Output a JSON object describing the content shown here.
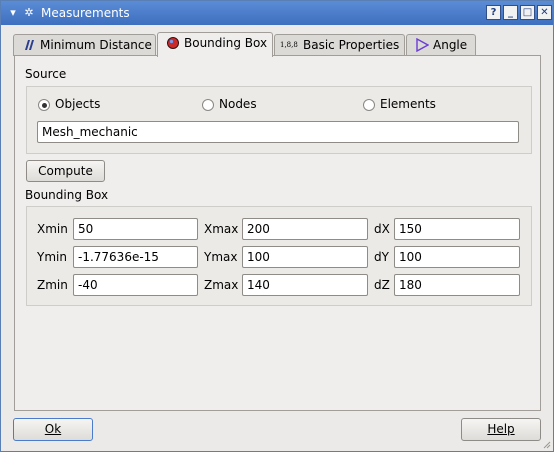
{
  "window": {
    "title": "Measurements",
    "controls": [
      "?",
      "_",
      "□",
      "✕"
    ]
  },
  "tabs": [
    {
      "label": "Minimum Distance",
      "icon": "minimum-distance-icon",
      "active": false
    },
    {
      "label": "Bounding Box",
      "icon": "bounding-box-icon",
      "active": true
    },
    {
      "label": "Basic Properties",
      "icon": "basic-properties-icon",
      "icon_text": "1,8,8",
      "active": false
    },
    {
      "label": "Angle",
      "icon": "angle-icon",
      "active": false
    }
  ],
  "source": {
    "label": "Source",
    "options": [
      {
        "label": "Objects",
        "selected": true
      },
      {
        "label": "Nodes",
        "selected": false
      },
      {
        "label": "Elements",
        "selected": false
      }
    ],
    "object_name": "Mesh_mechanic"
  },
  "compute_label": "Compute",
  "bbox": {
    "label": "Bounding Box",
    "rows": [
      {
        "min_label": "Xmin",
        "min": "50",
        "max_label": "Xmax",
        "max": "200",
        "d_label": "dX",
        "d": "150"
      },
      {
        "min_label": "Ymin",
        "min": "-1.77636e-15",
        "max_label": "Ymax",
        "max": "100",
        "d_label": "dY",
        "d": "100"
      },
      {
        "min_label": "Zmin",
        "min": "-40",
        "max_label": "Zmax",
        "max": "140",
        "d_label": "dZ",
        "d": "180"
      }
    ]
  },
  "footer": {
    "ok_label": "Ok",
    "help_label": "Help"
  },
  "colors": {
    "titlebar": "#4a7ccb",
    "accent_angle": "#6b3cd6",
    "bbox_icon": "#cc2a2a"
  }
}
